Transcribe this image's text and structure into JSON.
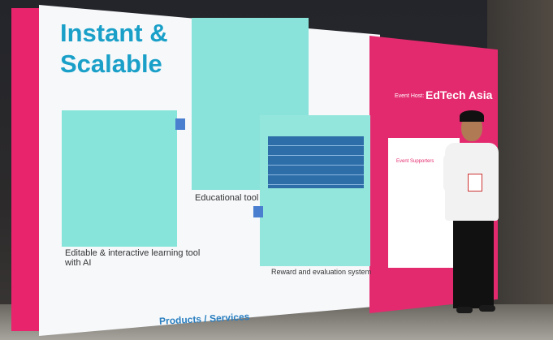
{
  "slide": {
    "title_line1": "Instant &",
    "title_line2": "Scalable",
    "caption_left": "Editable & interactive learning tool",
    "caption_left2": "with AI",
    "caption_mid": "Educational tool",
    "caption_right": "Reward and evaluation system",
    "footer": "Products / Services",
    "event_host_label": "Event Host:",
    "brand": "EdTech Asia",
    "supporters_label": "Event Supporters"
  },
  "colors": {
    "accent_pink": "#e42a6e",
    "title_blue": "#1aa0c8",
    "panel_teal": "#86e4da"
  }
}
